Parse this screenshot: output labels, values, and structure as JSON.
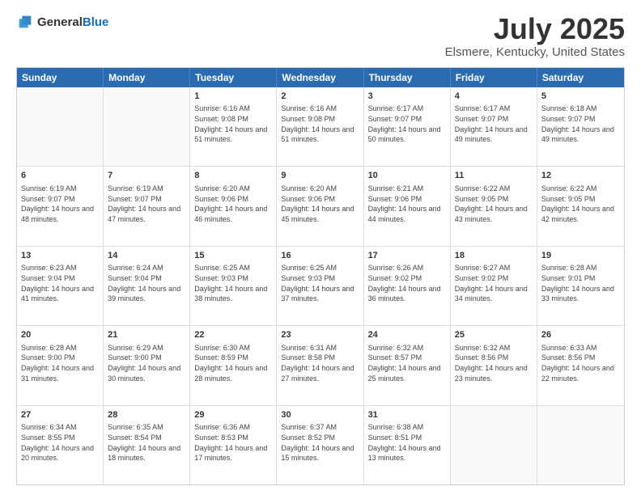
{
  "header": {
    "logo_general": "General",
    "logo_blue": "Blue",
    "title": "July 2025",
    "subtitle": "Elsmere, Kentucky, United States"
  },
  "calendar": {
    "days_of_week": [
      "Sunday",
      "Monday",
      "Tuesday",
      "Wednesday",
      "Thursday",
      "Friday",
      "Saturday"
    ],
    "weeks": [
      [
        {
          "day": "",
          "empty": true
        },
        {
          "day": "",
          "empty": true
        },
        {
          "day": "1",
          "sunrise": "Sunrise: 6:16 AM",
          "sunset": "Sunset: 9:08 PM",
          "daylight": "Daylight: 14 hours and 51 minutes."
        },
        {
          "day": "2",
          "sunrise": "Sunrise: 6:16 AM",
          "sunset": "Sunset: 9:08 PM",
          "daylight": "Daylight: 14 hours and 51 minutes."
        },
        {
          "day": "3",
          "sunrise": "Sunrise: 6:17 AM",
          "sunset": "Sunset: 9:07 PM",
          "daylight": "Daylight: 14 hours and 50 minutes."
        },
        {
          "day": "4",
          "sunrise": "Sunrise: 6:17 AM",
          "sunset": "Sunset: 9:07 PM",
          "daylight": "Daylight: 14 hours and 49 minutes."
        },
        {
          "day": "5",
          "sunrise": "Sunrise: 6:18 AM",
          "sunset": "Sunset: 9:07 PM",
          "daylight": "Daylight: 14 hours and 49 minutes."
        }
      ],
      [
        {
          "day": "6",
          "sunrise": "Sunrise: 6:19 AM",
          "sunset": "Sunset: 9:07 PM",
          "daylight": "Daylight: 14 hours and 48 minutes."
        },
        {
          "day": "7",
          "sunrise": "Sunrise: 6:19 AM",
          "sunset": "Sunset: 9:07 PM",
          "daylight": "Daylight: 14 hours and 47 minutes."
        },
        {
          "day": "8",
          "sunrise": "Sunrise: 6:20 AM",
          "sunset": "Sunset: 9:06 PM",
          "daylight": "Daylight: 14 hours and 46 minutes."
        },
        {
          "day": "9",
          "sunrise": "Sunrise: 6:20 AM",
          "sunset": "Sunset: 9:06 PM",
          "daylight": "Daylight: 14 hours and 45 minutes."
        },
        {
          "day": "10",
          "sunrise": "Sunrise: 6:21 AM",
          "sunset": "Sunset: 9:06 PM",
          "daylight": "Daylight: 14 hours and 44 minutes."
        },
        {
          "day": "11",
          "sunrise": "Sunrise: 6:22 AM",
          "sunset": "Sunset: 9:05 PM",
          "daylight": "Daylight: 14 hours and 43 minutes."
        },
        {
          "day": "12",
          "sunrise": "Sunrise: 6:22 AM",
          "sunset": "Sunset: 9:05 PM",
          "daylight": "Daylight: 14 hours and 42 minutes."
        }
      ],
      [
        {
          "day": "13",
          "sunrise": "Sunrise: 6:23 AM",
          "sunset": "Sunset: 9:04 PM",
          "daylight": "Daylight: 14 hours and 41 minutes."
        },
        {
          "day": "14",
          "sunrise": "Sunrise: 6:24 AM",
          "sunset": "Sunset: 9:04 PM",
          "daylight": "Daylight: 14 hours and 39 minutes."
        },
        {
          "day": "15",
          "sunrise": "Sunrise: 6:25 AM",
          "sunset": "Sunset: 9:03 PM",
          "daylight": "Daylight: 14 hours and 38 minutes."
        },
        {
          "day": "16",
          "sunrise": "Sunrise: 6:25 AM",
          "sunset": "Sunset: 9:03 PM",
          "daylight": "Daylight: 14 hours and 37 minutes."
        },
        {
          "day": "17",
          "sunrise": "Sunrise: 6:26 AM",
          "sunset": "Sunset: 9:02 PM",
          "daylight": "Daylight: 14 hours and 36 minutes."
        },
        {
          "day": "18",
          "sunrise": "Sunrise: 6:27 AM",
          "sunset": "Sunset: 9:02 PM",
          "daylight": "Daylight: 14 hours and 34 minutes."
        },
        {
          "day": "19",
          "sunrise": "Sunrise: 6:28 AM",
          "sunset": "Sunset: 9:01 PM",
          "daylight": "Daylight: 14 hours and 33 minutes."
        }
      ],
      [
        {
          "day": "20",
          "sunrise": "Sunrise: 6:28 AM",
          "sunset": "Sunset: 9:00 PM",
          "daylight": "Daylight: 14 hours and 31 minutes."
        },
        {
          "day": "21",
          "sunrise": "Sunrise: 6:29 AM",
          "sunset": "Sunset: 9:00 PM",
          "daylight": "Daylight: 14 hours and 30 minutes."
        },
        {
          "day": "22",
          "sunrise": "Sunrise: 6:30 AM",
          "sunset": "Sunset: 8:59 PM",
          "daylight": "Daylight: 14 hours and 28 minutes."
        },
        {
          "day": "23",
          "sunrise": "Sunrise: 6:31 AM",
          "sunset": "Sunset: 8:58 PM",
          "daylight": "Daylight: 14 hours and 27 minutes."
        },
        {
          "day": "24",
          "sunrise": "Sunrise: 6:32 AM",
          "sunset": "Sunset: 8:57 PM",
          "daylight": "Daylight: 14 hours and 25 minutes."
        },
        {
          "day": "25",
          "sunrise": "Sunrise: 6:32 AM",
          "sunset": "Sunset: 8:56 PM",
          "daylight": "Daylight: 14 hours and 23 minutes."
        },
        {
          "day": "26",
          "sunrise": "Sunrise: 6:33 AM",
          "sunset": "Sunset: 8:56 PM",
          "daylight": "Daylight: 14 hours and 22 minutes."
        }
      ],
      [
        {
          "day": "27",
          "sunrise": "Sunrise: 6:34 AM",
          "sunset": "Sunset: 8:55 PM",
          "daylight": "Daylight: 14 hours and 20 minutes."
        },
        {
          "day": "28",
          "sunrise": "Sunrise: 6:35 AM",
          "sunset": "Sunset: 8:54 PM",
          "daylight": "Daylight: 14 hours and 18 minutes."
        },
        {
          "day": "29",
          "sunrise": "Sunrise: 6:36 AM",
          "sunset": "Sunset: 8:53 PM",
          "daylight": "Daylight: 14 hours and 17 minutes."
        },
        {
          "day": "30",
          "sunrise": "Sunrise: 6:37 AM",
          "sunset": "Sunset: 8:52 PM",
          "daylight": "Daylight: 14 hours and 15 minutes."
        },
        {
          "day": "31",
          "sunrise": "Sunrise: 6:38 AM",
          "sunset": "Sunset: 8:51 PM",
          "daylight": "Daylight: 14 hours and 13 minutes."
        },
        {
          "day": "",
          "empty": true
        },
        {
          "day": "",
          "empty": true
        }
      ]
    ]
  }
}
